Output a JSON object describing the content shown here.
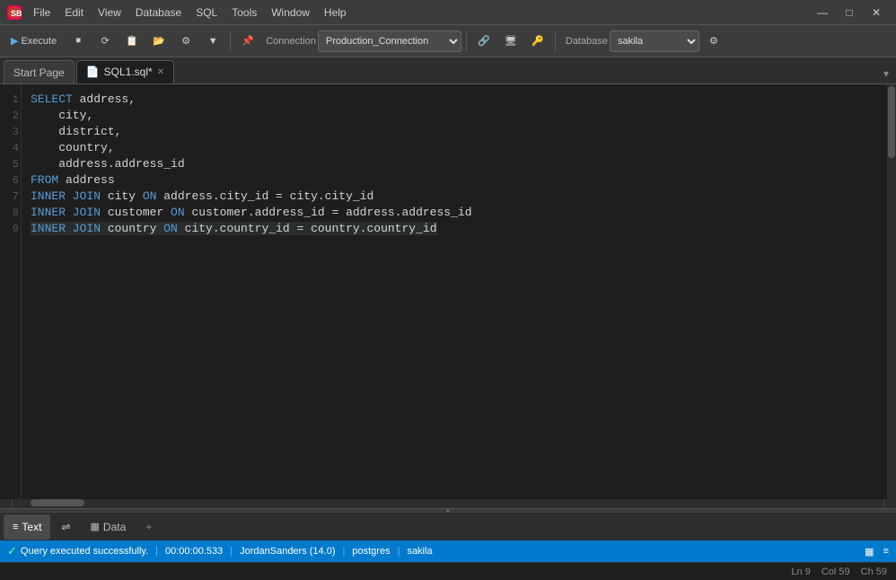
{
  "titlebar": {
    "logo": "SB",
    "menus": [
      "File",
      "Edit",
      "View",
      "Database",
      "SQL",
      "Tools",
      "Window",
      "Help"
    ],
    "controls": [
      "—",
      "□",
      "✕"
    ]
  },
  "toolbar": {
    "execute_label": "Execute",
    "connection_label": "Connection",
    "connection_value": "Production_Connection",
    "database_label": "Database",
    "database_value": "sakila",
    "buttons": [
      "▶",
      "⏹",
      "⟳",
      "📋",
      "🗂",
      "⚙",
      "▼",
      "|",
      "⚙",
      "🔗",
      "|",
      "📌",
      "🖥",
      "🔑",
      "|",
      "⚙"
    ]
  },
  "tabs": {
    "start_page": "Start Page",
    "sql1": "SQL1.sql*",
    "overflow": "▾"
  },
  "editor": {
    "lines": [
      {
        "num": 1,
        "tokens": [
          {
            "text": "SELECT",
            "cls": "kw"
          },
          {
            "text": " address,",
            "cls": ""
          }
        ]
      },
      {
        "num": 2,
        "tokens": [
          {
            "text": "    city,",
            "cls": ""
          }
        ]
      },
      {
        "num": 3,
        "tokens": [
          {
            "text": "    district,",
            "cls": ""
          }
        ]
      },
      {
        "num": 4,
        "tokens": [
          {
            "text": "    country,",
            "cls": ""
          }
        ]
      },
      {
        "num": 5,
        "tokens": [
          {
            "text": "    address.address_id",
            "cls": ""
          }
        ]
      },
      {
        "num": 6,
        "tokens": [
          {
            "text": "FROM",
            "cls": "kw"
          },
          {
            "text": " address",
            "cls": ""
          }
        ]
      },
      {
        "num": 7,
        "tokens": [
          {
            "text": "INNER JOIN",
            "cls": "kw"
          },
          {
            "text": " city ",
            "cls": ""
          },
          {
            "text": "ON",
            "cls": "kw"
          },
          {
            "text": " address.city_id = city.city_id",
            "cls": ""
          }
        ]
      },
      {
        "num": 8,
        "tokens": [
          {
            "text": "INNER JOIN",
            "cls": "kw"
          },
          {
            "text": " customer ",
            "cls": ""
          },
          {
            "text": "ON",
            "cls": "kw"
          },
          {
            "text": " customer.address_id = address.address_id",
            "cls": ""
          }
        ]
      },
      {
        "num": 9,
        "tokens": [
          {
            "text": "INNER JOIN",
            "cls": "kw"
          },
          {
            "text": " country ",
            "cls": ""
          },
          {
            "text": "ON",
            "cls": "kw"
          },
          {
            "text": " city.country_id = country.country_id",
            "cls": ""
          }
        ]
      }
    ]
  },
  "bottom_tabs": {
    "text_label": "Text",
    "swap_label": "⇌",
    "data_label": "Data",
    "add_label": "+"
  },
  "status": {
    "ok_icon": "✓",
    "ok_text": "Query executed successfully.",
    "time": "00:00:00.533",
    "user": "JordanSanders (14.0)",
    "db1": "postgres",
    "db2": "sakila",
    "mode_icon": "▦",
    "more_icon": "≡"
  },
  "lineinfo": {
    "ln": "Ln 9",
    "col": "Col 59",
    "ch": "Ch 59"
  }
}
